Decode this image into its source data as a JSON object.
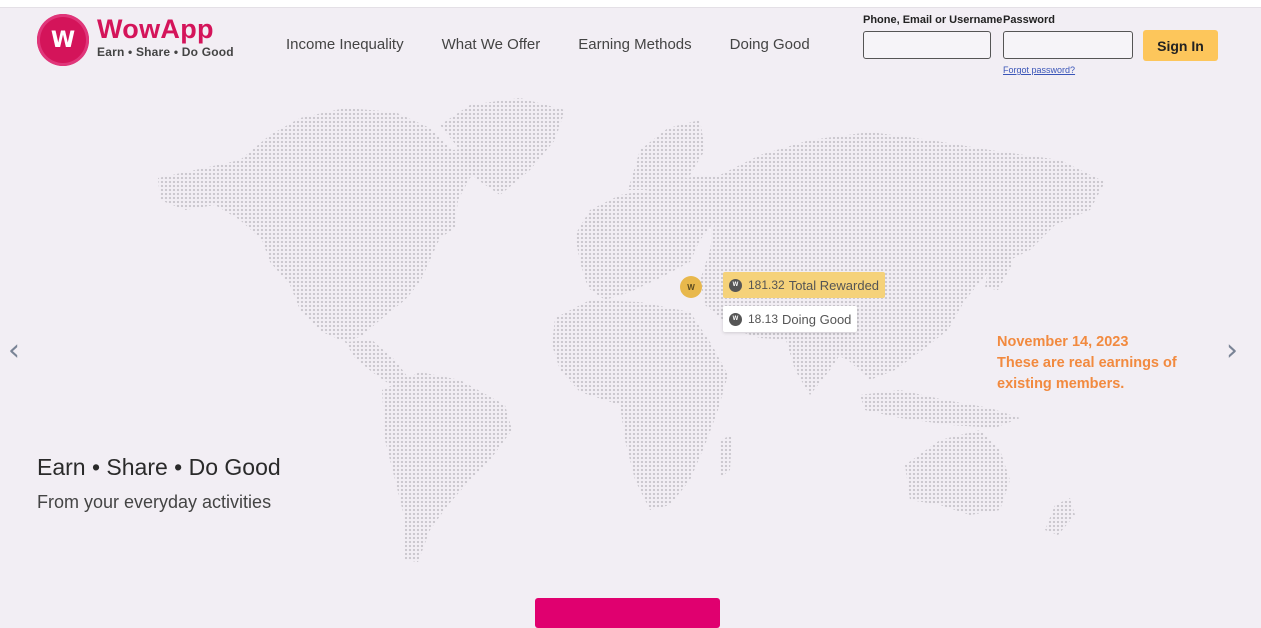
{
  "brand": {
    "name": "WowApp",
    "tagline": "Earn • Share • Do Good",
    "mark": "W",
    "color": "#d4145a"
  },
  "nav": [
    {
      "label": "Income Inequality"
    },
    {
      "label": "What We Offer"
    },
    {
      "label": "Earning Methods"
    },
    {
      "label": "Doing Good"
    }
  ],
  "login": {
    "user_label": "Phone, Email or Username",
    "user_value": "",
    "password_label": "Password",
    "password_value": "",
    "signin_label": "Sign In",
    "forgot_label": "Forgot password?"
  },
  "map": {
    "marker_label": "W",
    "total_value": "181.32",
    "total_label": "Total Rewarded",
    "good_value": "18.13",
    "good_label": "Doing Good"
  },
  "notice": {
    "date": "November 14, 2023",
    "line1": "These are real earnings of",
    "line2": "existing members."
  },
  "hero": {
    "title": "Earn • Share • Do Good",
    "subtitle": "From your everyday activities"
  },
  "carousel": {
    "prev_icon": "‹",
    "next_icon": "›"
  },
  "colors": {
    "accent": "#fdc65b",
    "cta": "#e0006f",
    "notice": "#f28a3f",
    "background": "#f2eef4"
  }
}
